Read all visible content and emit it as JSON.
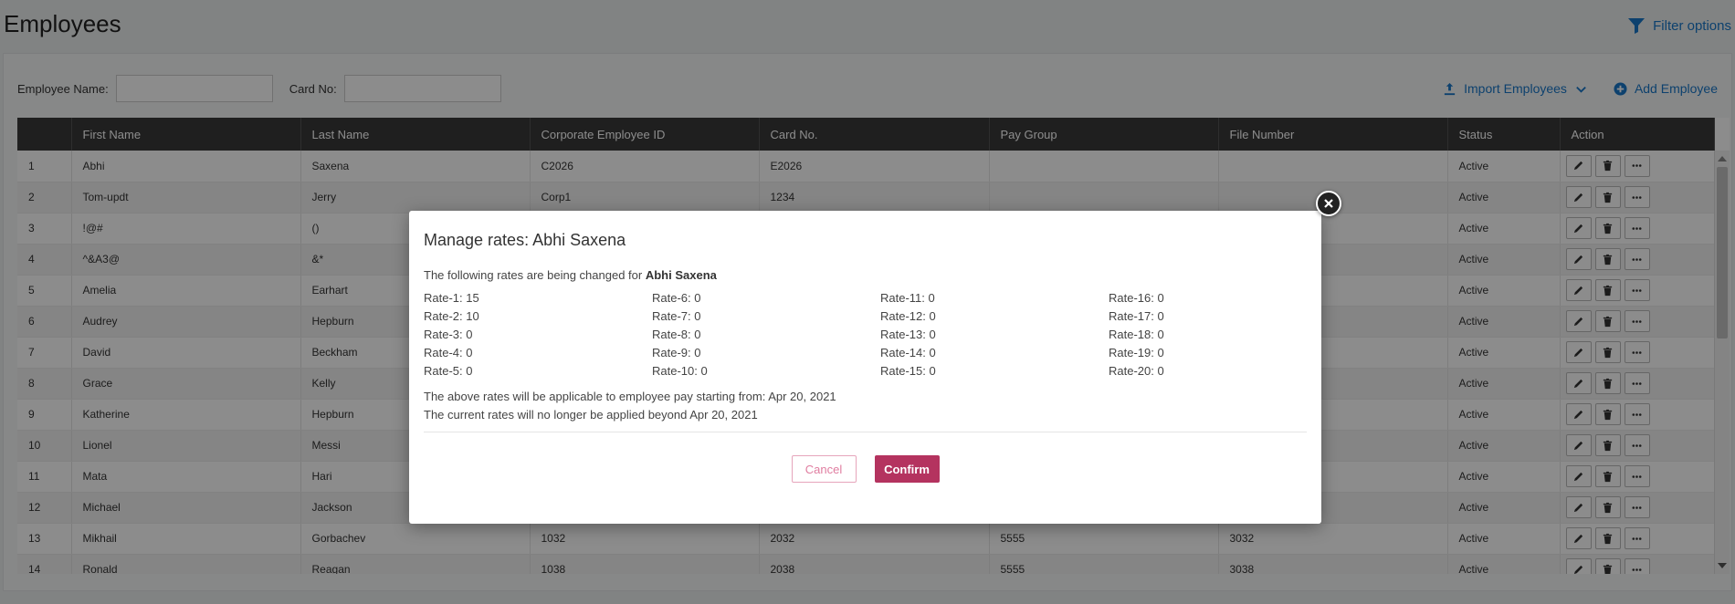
{
  "page": {
    "title": "Employees",
    "filter_label": "Filter options"
  },
  "search": {
    "employee_name_label": "Employee Name:",
    "employee_name_value": "",
    "card_no_label": "Card No:",
    "card_no_value": ""
  },
  "toolbar": {
    "import_label": "Import Employees",
    "add_label": "Add Employee"
  },
  "table": {
    "columns": [
      "",
      "First Name",
      "Last Name",
      "Corporate Employee ID",
      "Card No.",
      "Pay Group",
      "File Number",
      "Status",
      "Action"
    ],
    "rows": [
      [
        "1",
        "Abhi",
        "Saxena",
        "C2026",
        "E2026",
        "",
        "",
        "Active"
      ],
      [
        "2",
        "Tom-updt",
        "Jerry",
        "Corp1",
        "1234",
        "",
        "",
        "Active"
      ],
      [
        "3",
        "!@#",
        "()",
        "",
        "",
        "",
        "",
        "Active"
      ],
      [
        "4",
        "^&A3@",
        "&*",
        "",
        "",
        "",
        "",
        "Active"
      ],
      [
        "5",
        "Amelia",
        "Earhart",
        "",
        "",
        "",
        "",
        "Active"
      ],
      [
        "6",
        "Audrey",
        "Hepburn",
        "",
        "",
        "",
        "",
        "Active"
      ],
      [
        "7",
        "David",
        "Beckham",
        "",
        "",
        "",
        "",
        "Active"
      ],
      [
        "8",
        "Grace",
        "Kelly",
        "",
        "",
        "",
        "",
        "Active"
      ],
      [
        "9",
        "Katherine",
        "Hepburn",
        "",
        "",
        "",
        "",
        "Active"
      ],
      [
        "10",
        "Lionel",
        "Messi",
        "",
        "",
        "",
        "",
        "Active"
      ],
      [
        "11",
        "Mata",
        "Hari",
        "",
        "",
        "",
        "",
        "Active"
      ],
      [
        "12",
        "Michael",
        "Jackson",
        "",
        "",
        "",
        "",
        "Active"
      ],
      [
        "13",
        "Mikhail",
        "Gorbachev",
        "1032",
        "2032",
        "5555",
        "3032",
        "Active"
      ],
      [
        "14",
        "Ronald",
        "Reagan",
        "1038",
        "2038",
        "5555",
        "3038",
        "Active"
      ]
    ]
  },
  "modal": {
    "title": "Manage rates: Abhi Saxena",
    "intro_prefix": "The following rates are being changed for",
    "employee_name": "Abhi Saxena",
    "rates": [
      "Rate-1: 15",
      "Rate-2: 10",
      "Rate-3: 0",
      "Rate-4: 0",
      "Rate-5: 0",
      "Rate-6: 0",
      "Rate-7: 0",
      "Rate-8: 0",
      "Rate-9: 0",
      "Rate-10: 0",
      "Rate-11: 0",
      "Rate-12: 0",
      "Rate-13: 0",
      "Rate-14: 0",
      "Rate-15: 0",
      "Rate-16: 0",
      "Rate-17: 0",
      "Rate-18: 0",
      "Rate-19: 0",
      "Rate-20: 0"
    ],
    "note_start": "The above rates will be applicable to employee pay starting from: Apr 20, 2021",
    "note_end": "The current rates will no longer be applied beyond Apr 20, 2021",
    "cancel_label": "Cancel",
    "confirm_label": "Confirm"
  },
  "colors": {
    "accent": "#1877c8",
    "header_bg": "#3a3a3a",
    "confirm_bg": "#b4335f",
    "cancel_border": "#e6a5bb"
  }
}
